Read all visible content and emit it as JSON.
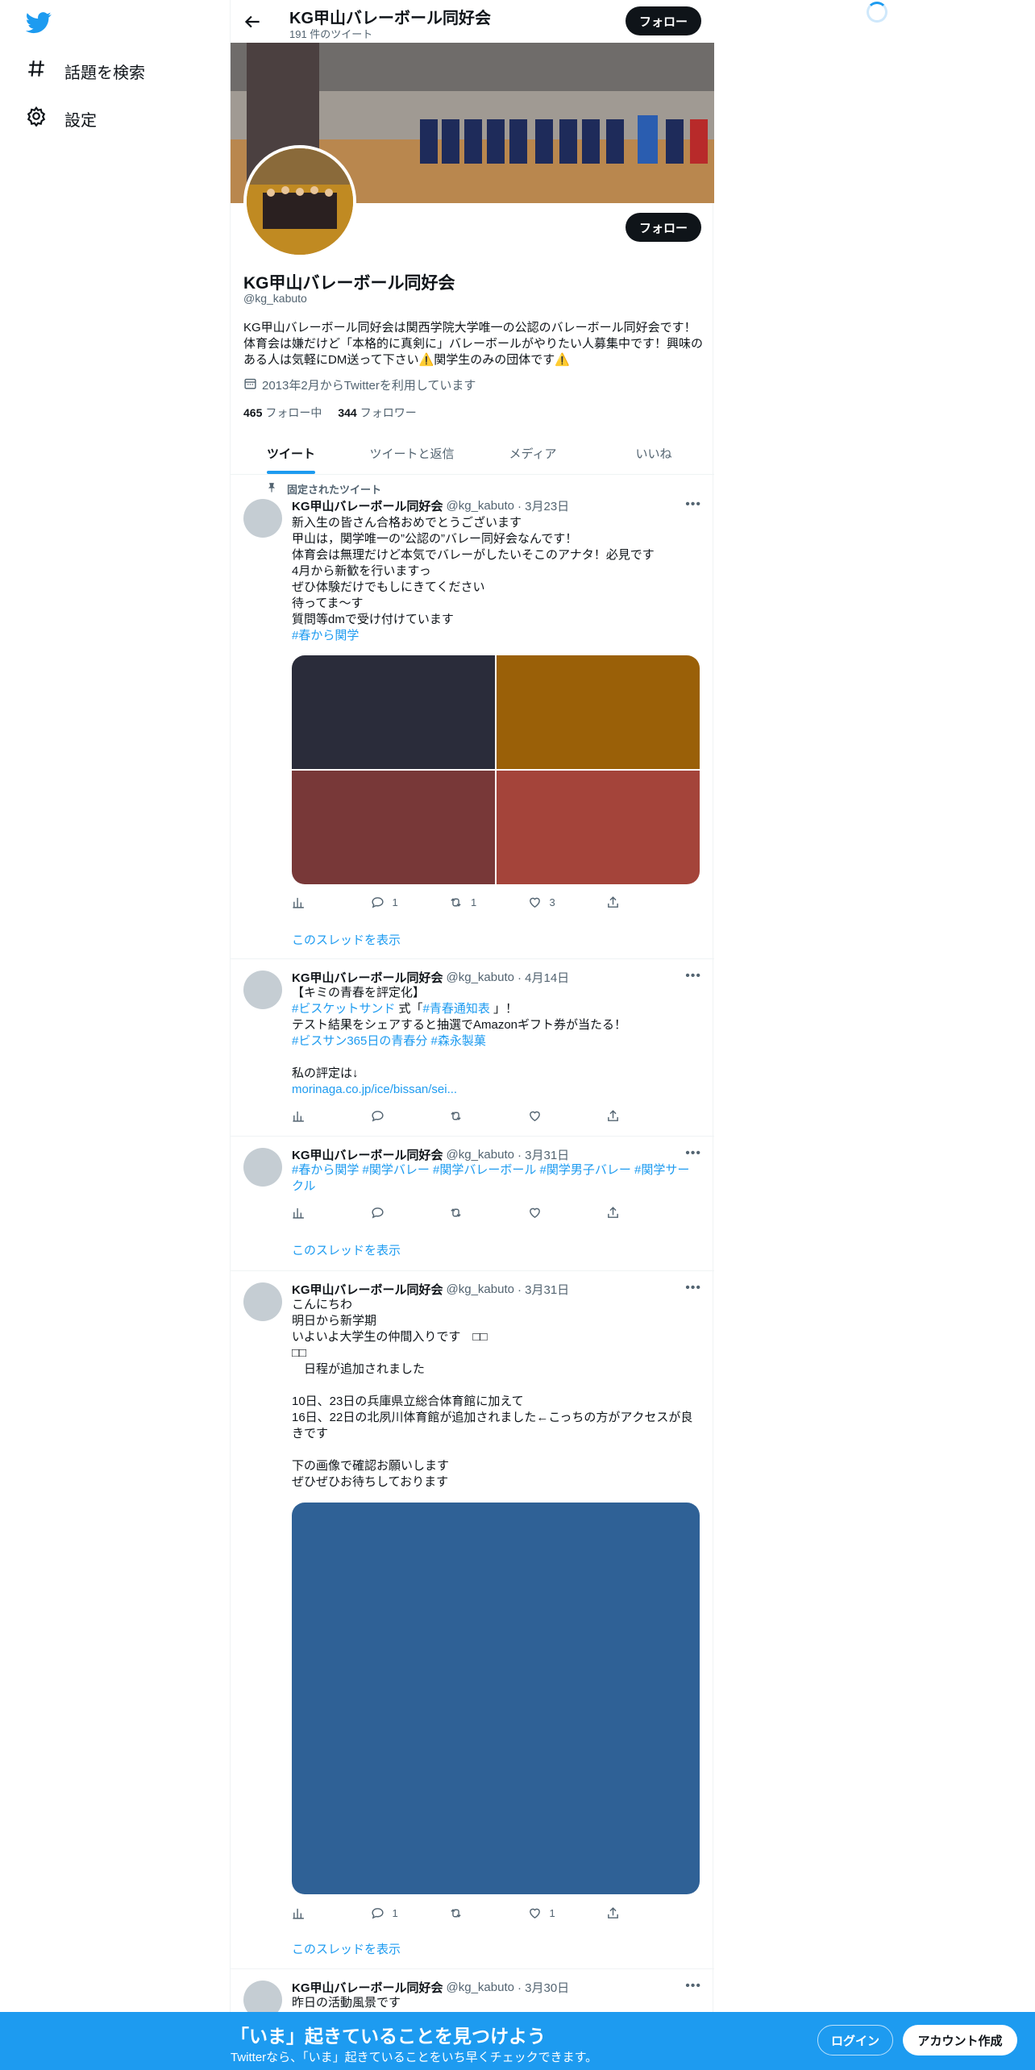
{
  "nav": {
    "explore_label": "話題を検索",
    "settings_label": "設定",
    "brand_color": "#1d9bf0"
  },
  "header": {
    "name": "KG甲山バレーボール同好会",
    "tweet_count": "191 件のツイート",
    "follow_label": "フォロー"
  },
  "profile": {
    "name": "KG甲山バレーボール同好会",
    "handle": "@kg_kabuto",
    "bio": "KG甲山バレーボール同好会は関西学院大学唯一の公認のバレーボール同好会です！体育会は嫌だけど「本格的に真剣に」バレーボールがやりたい人募集中です！興味のある人は気軽にDM送って下さい⚠️関学生のみの団体です⚠️",
    "joined": "2013年2月からTwitterを利用しています",
    "following_count": "465",
    "following_label": "フォロー中",
    "followers_count": "344",
    "followers_label": "フォロワー",
    "follow_label": "フォロー"
  },
  "tabs": [
    {
      "label": "ツイート",
      "active": true
    },
    {
      "label": "ツイートと返信",
      "active": false
    },
    {
      "label": "メディア",
      "active": false
    },
    {
      "label": "いいね",
      "active": false
    }
  ],
  "tweets": [
    {
      "pinned_label": "固定されたツイート",
      "name": "KG甲山バレーボール同好会",
      "handle": "@kg_kabuto",
      "date": "· 3月23日",
      "text": "新入生の皆さん合格おめでとうございます\n甲山は，関学唯一の”公認の”バレー同好会なんです！\n体育会は無理だけど本気でバレーがしたいそこのアナタ！必見です\n4月から新歓を行いますっ\nぜひ体験だけでもしにきてください\n待ってま〜す\n質問等dmで受け付けています",
      "hashtag": "#春から関学",
      "image_colors": [
        "#2a2c3a",
        "#9a6008",
        "#783838",
        "#a4443a"
      ],
      "replies": "1",
      "retweets": "1",
      "likes": "3",
      "thread_label": "このスレッドを表示"
    },
    {
      "name": "KG甲山バレーボール同好会",
      "handle": "@kg_kabuto",
      "date": "· 4月14日",
      "line1": "【キミの青春を評定化】",
      "tag1": "#ビスケットサンド",
      "mid": " 式「",
      "tag2": "#青春通知表",
      "end": " 」！",
      "line3": "テスト結果をシェアすると抽選でAmazonギフト券が当たる！",
      "tags": "#ビスサン365日の青春分 #森永製菓",
      "line5": "私の評定は↓",
      "url": "morinaga.co.jp/ice/bissan/sei..."
    },
    {
      "name": "KG甲山バレーボール同好会",
      "handle": "@kg_kabuto",
      "date": "· 3月31日",
      "tags": "#春から関学 #関学バレー #関学バレーボール #関学男子バレー #関学サークル",
      "thread_label": "このスレッドを表示"
    },
    {
      "name": "KG甲山バレーボール同好会",
      "handle": "@kg_kabuto",
      "date": "· 3月31日",
      "text": "こんにちわ\n明日から新学期\nいよいよ大学生の仲間入りです　□□\n□□\n　日程が追加されました\n\n10日、23日の兵庫県立総合体育館に加えて\n16日、22日の北夙川体育館が追加されました←こっちの方がアクセスが良きです\n\n下の画像で確認お願いします\nぜひぜひお待ちしております",
      "image_color": "#2f6196",
      "replies": "1",
      "likes": "1",
      "thread_label": "このスレッドを表示"
    },
    {
      "name": "KG甲山バレーボール同好会",
      "handle": "@kg_kabuto",
      "date": "· 3月30日",
      "text": "昨日の活動風景です"
    }
  ],
  "bottom": {
    "title": "「いま」起きていることを見つけよう",
    "subtitle": "Twitterなら、「いま」起きていることをいち早くチェックできます。",
    "login_label": "ログイン",
    "signup_label": "アカウント作成"
  }
}
